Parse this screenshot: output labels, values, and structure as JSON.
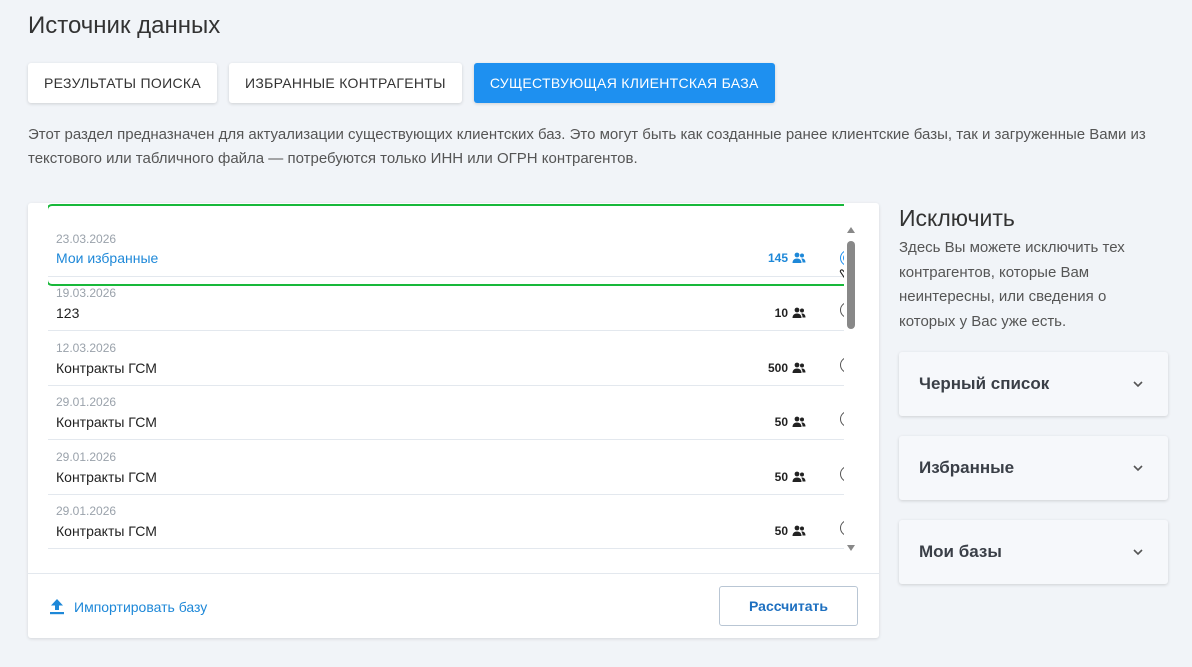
{
  "page": {
    "title": "Источник данных",
    "description": "Этот раздел предназначен для актуализации существующих клиентских баз. Это могут быть как созданные ранее клиентские базы, так и загруженные Вами из текстового или табличного файла — потребуются только ИНН или ОГРН контрагентов."
  },
  "tabs": [
    {
      "label": "Результаты поиска",
      "active": false
    },
    {
      "label": "Избранные контрагенты",
      "active": false
    },
    {
      "label": "Существующая клиентская база",
      "active": true
    }
  ],
  "bases": [
    {
      "date": "23.03.2026",
      "name": "Мои избранные",
      "count": "145",
      "selected": true
    },
    {
      "date": "19.03.2026",
      "name": "123",
      "count": "10",
      "selected": false
    },
    {
      "date": "12.03.2026",
      "name": "Контракты ГСМ",
      "count": "500",
      "selected": false
    },
    {
      "date": "29.01.2026",
      "name": "Контракты ГСМ",
      "count": "50",
      "selected": false
    },
    {
      "date": "29.01.2026",
      "name": "Контракты ГСМ",
      "count": "50",
      "selected": false
    },
    {
      "date": "29.01.2026",
      "name": "Контракты ГСМ",
      "count": "50",
      "selected": false
    }
  ],
  "footer": {
    "import_label": "Импортировать базу",
    "calculate_label": "Рассчитать"
  },
  "exclude": {
    "title": "Исключить",
    "description": "Здесь Вы можете исключить тех контрагентов, которые Вам неинтересны, или сведения о которых у Вас уже есть.",
    "sections": [
      {
        "label": "Черный список"
      },
      {
        "label": "Избранные"
      },
      {
        "label": "Мои базы"
      }
    ]
  },
  "colors": {
    "accent": "#1e90f0",
    "highlight": "#18b83a",
    "background": "#f1f4f8"
  },
  "icons": [
    "people-icon",
    "upload-icon",
    "chevron-down-icon",
    "hand-pointer-icon"
  ]
}
